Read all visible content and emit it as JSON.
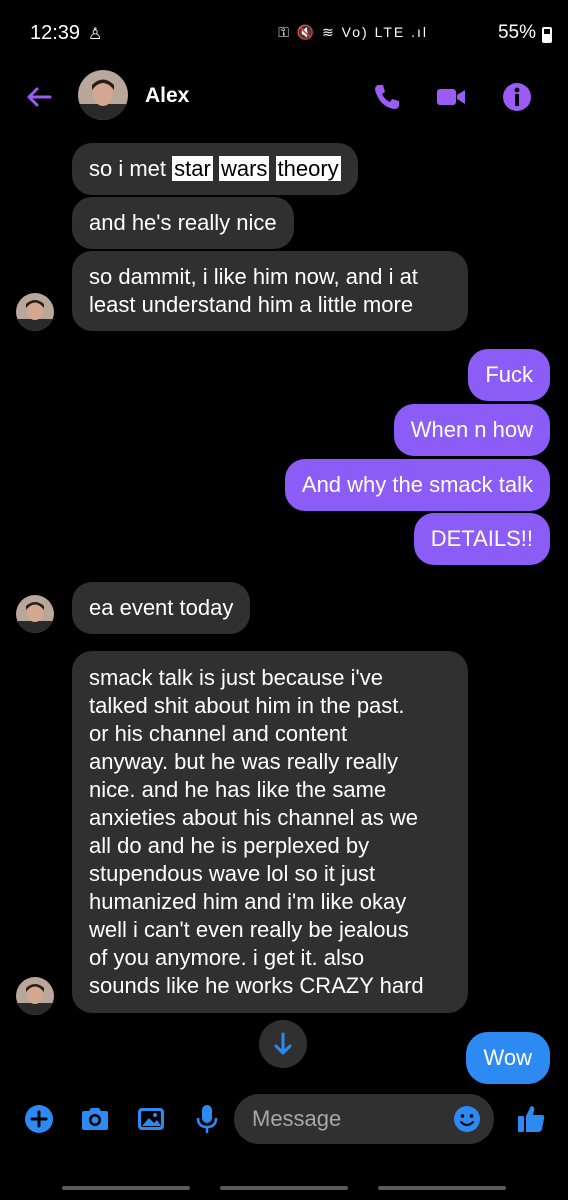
{
  "status_bar": {
    "time": "12:39",
    "icons": "⚿ 🔇 ≋ Vo) LTE .ıl",
    "battery": "55%"
  },
  "header": {
    "contact_name": "Alex",
    "icons": [
      "back-arrow-icon",
      "phone-icon",
      "video-icon",
      "info-icon"
    ],
    "accent_color": "#9b5cf6"
  },
  "messages": [
    {
      "side": "in",
      "parts": [
        "so i met ",
        "star",
        " ",
        "wars",
        " ",
        "theory"
      ]
    },
    {
      "side": "in",
      "text": "and he's really nice"
    },
    {
      "side": "in",
      "lines": [
        "so dammit, i like him now, and i at",
        "least understand him a little more"
      ]
    },
    {
      "side": "out",
      "text": "Fuck"
    },
    {
      "side": "out",
      "text": "When n how"
    },
    {
      "side": "out",
      "text": "And why the smack talk"
    },
    {
      "side": "out",
      "text": "DETAILS!!"
    },
    {
      "side": "in",
      "text": "ea event today"
    },
    {
      "side": "in",
      "lines": [
        "smack talk is just because i've",
        "talked shit about him in the past.",
        "or his channel and content",
        "anyway. but he was really really",
        "nice. and he has like the same",
        "anxieties about his channel as we",
        "all do and he is perplexed by",
        "stupendous wave lol so it just",
        "humanized him and i'm like okay",
        "well i can't even really be jealous",
        "of you anymore. i get it. also",
        "sounds like he works CRAZY hard"
      ]
    },
    {
      "side": "out",
      "text": "Wow"
    }
  ],
  "composer": {
    "placeholder": "Message",
    "icons": [
      "plus-icon",
      "camera-icon",
      "gallery-icon",
      "mic-icon",
      "emoji-icon",
      "thumbs-up-icon"
    ]
  },
  "colors": {
    "outgoing_bubble": "#8b5cf6",
    "incoming_bubble": "#303030",
    "last_outgoing_bubble": "#2e8af3",
    "composer_icon": "#2e8af3"
  }
}
